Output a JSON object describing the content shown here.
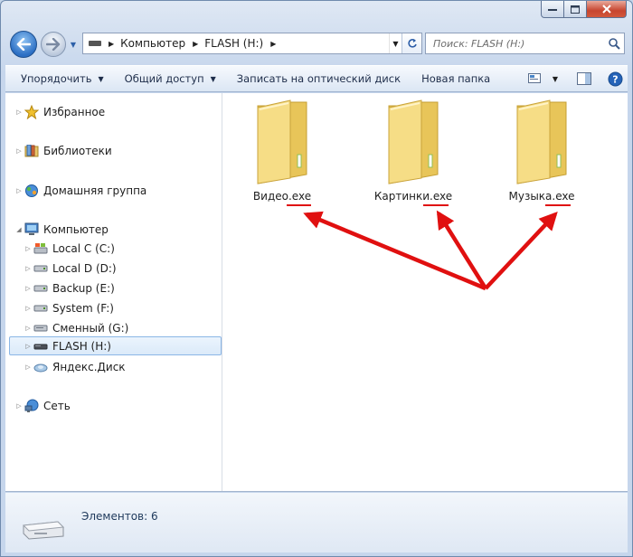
{
  "window": {
    "caption": {
      "minimize": "▁",
      "maximize": "□",
      "close": "✕"
    }
  },
  "nav": {
    "back_icon": "back-arrow-icon",
    "forward_icon": "forward-arrow-icon",
    "address": {
      "crumbs": [
        "Компьютер",
        "FLASH (H:)"
      ]
    },
    "search": {
      "placeholder": "Поиск: FLASH (H:)"
    }
  },
  "toolbar": {
    "organize": "Упорядочить",
    "share": "Общий доступ",
    "burn": "Записать на оптический диск",
    "new_folder": "Новая папка"
  },
  "sidebar": {
    "favorites": "Избранное",
    "libraries": "Библиотеки",
    "homegroup": "Домашняя группа",
    "computer": "Компьютер",
    "drives": [
      "Local C (C:)",
      "Local D (D:)",
      "Backup (E:)",
      "System (F:)",
      "Сменный (G:)",
      "FLASH (H:)",
      "Яндекс.Диск"
    ],
    "network": "Сеть"
  },
  "files": [
    {
      "base": "Видео",
      "ext": ".exe"
    },
    {
      "base": "Картинки",
      "ext": ".exe"
    },
    {
      "base": "Музыка",
      "ext": ".exe"
    }
  ],
  "details": {
    "count": "Элементов: 6"
  },
  "colors": {
    "annotation": "#e01010",
    "selection": "#dbeaf9",
    "folder": "#f3d679"
  }
}
